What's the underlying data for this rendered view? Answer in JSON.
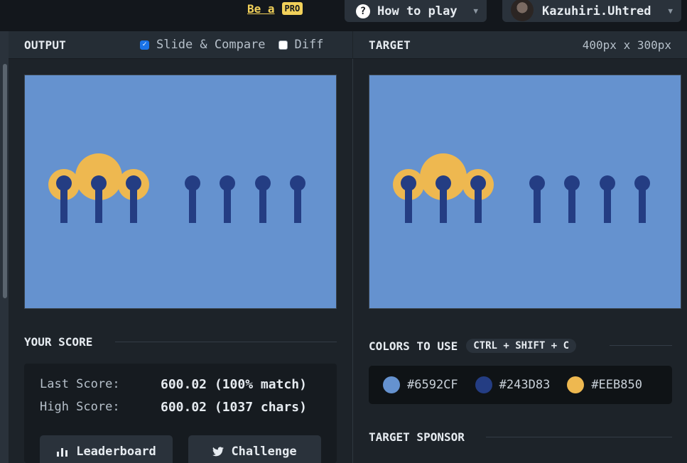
{
  "topbar": {
    "pro_prefix": "Be a",
    "pro_badge": "PRO",
    "howto_label": "How to play",
    "username": "Kazuhiri.Uhtred"
  },
  "output_panel": {
    "title": "OUTPUT",
    "slide_compare_label": "Slide & Compare",
    "slide_compare_checked": true,
    "diff_label": "Diff",
    "diff_checked": false
  },
  "target_panel": {
    "title": "TARGET",
    "dimensions": "400px x 300px"
  },
  "score": {
    "title": "YOUR SCORE",
    "last_label": "Last Score:",
    "last_value": "600.02 (100% match)",
    "high_label": "High Score:",
    "high_value": "600.02 (1037 chars)",
    "leaderboard_label": "Leaderboard",
    "challenge_label": "Challenge"
  },
  "colors": {
    "title": "COLORS TO USE",
    "shortcut": "CTRL + SHIFT + C",
    "list": [
      {
        "hex": "#6592CF",
        "label": "#6592CF"
      },
      {
        "hex": "#243D83",
        "label": "#243D83"
      },
      {
        "hex": "#EEB850",
        "label": "#EEB850"
      }
    ]
  },
  "sponsor": {
    "title": "TARGET SPONSOR"
  }
}
